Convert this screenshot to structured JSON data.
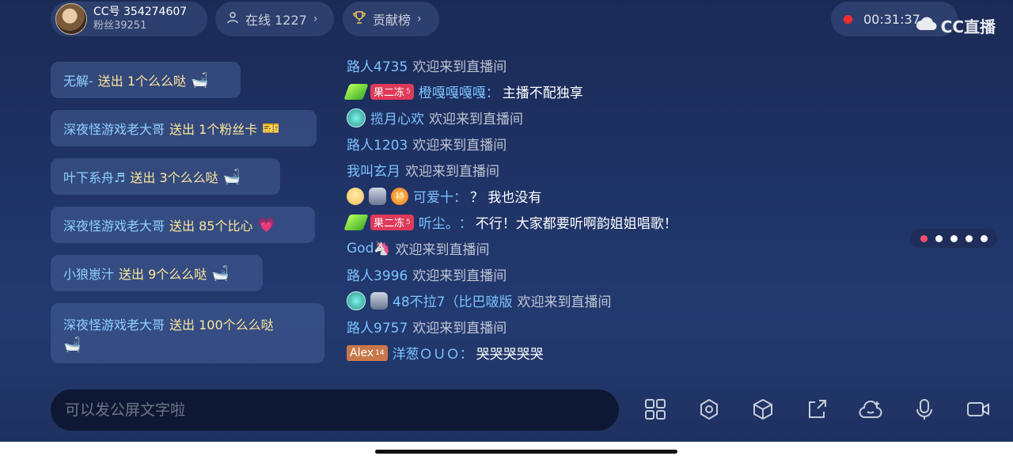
{
  "anchor": {
    "cc_id": "CC号 354274607",
    "fans": "粉丝39251"
  },
  "online": {
    "label": "在线 1227"
  },
  "rank": {
    "label": "贡献榜"
  },
  "timer": {
    "value": "00:31:37"
  },
  "brand": {
    "name": "CC直播"
  },
  "gifts": [
    {
      "user": "无解-",
      "action": "送出 1个么么哒",
      "icon": "tub-icon"
    },
    {
      "user": "深夜怪游戏老大哥",
      "action": "送出 1个粉丝卡",
      "icon": "fan-card-icon"
    },
    {
      "user": "叶下系舟♬",
      "action": "送出 3个么么哒",
      "icon": "tub-icon"
    },
    {
      "user": "深夜怪游戏老大哥",
      "action": "送出 85个比心",
      "icon": "heart-gesture-icon"
    },
    {
      "user": "小狼崽汁",
      "action": "送出 9个么么哒",
      "icon": "tub-icon"
    },
    {
      "user": "深夜怪游戏老大哥",
      "action": "送出 100个么么哒",
      "icon": "tub-icon"
    }
  ],
  "chat": [
    {
      "user": "路人4735",
      "welcome": "欢迎来到直播间"
    },
    {
      "badges": [
        "leaf",
        "fan"
      ],
      "fan_badge": "果二冻",
      "fan_level": "5",
      "user": "橙嘎嘎嘎嘎",
      "text": "主播不配独享"
    },
    {
      "badges": [
        "gem"
      ],
      "user": "揽月心欢",
      "welcome": "欢迎来到直播间"
    },
    {
      "user": "路人1203",
      "welcome": "欢迎来到直播间"
    },
    {
      "user": "我叫玄月",
      "welcome": "欢迎来到直播间"
    },
    {
      "badges": [
        "face",
        "shield",
        "orb"
      ],
      "orb_level": "15",
      "user": "可爱十",
      "text": "？ 我也没有"
    },
    {
      "badges": [
        "leaf",
        "fan"
      ],
      "fan_badge": "果二冻",
      "fan_level": "5",
      "user": "听尘。",
      "text": "不行！大家都要听啊韵姐姐唱歌！"
    },
    {
      "user": "God🦄",
      "welcome": "欢迎来到直播间"
    },
    {
      "user": "路人3996",
      "welcome": "欢迎来到直播间"
    },
    {
      "badges": [
        "gem",
        "shield"
      ],
      "user": "48不拉7（比巴啵版",
      "welcome": "欢迎来到直播间"
    },
    {
      "user": "路人9757",
      "welcome": "欢迎来到直播间"
    },
    {
      "badges": [
        "alex"
      ],
      "alex_badge": "Alex",
      "alex_level": "14",
      "user": "洋葱ＯＵＯ",
      "text": "哭哭哭哭哭"
    }
  ],
  "input": {
    "placeholder": "可以发公屏文字啦"
  },
  "pager": {
    "count": 5,
    "active": 0
  },
  "toolbar": [
    "grid-icon",
    "gear-icon",
    "cube-icon",
    "share-icon",
    "cloud-emoji-icon",
    "microphone-icon",
    "video-camera-icon"
  ]
}
